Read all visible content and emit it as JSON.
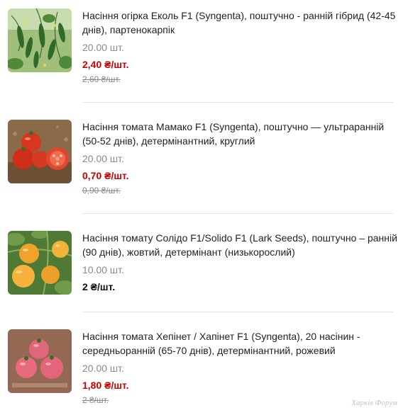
{
  "products": [
    {
      "image": "cucumber-photo",
      "title": "Насіння огірка Еколь F1 (Syngenta), поштучно - ранній гібрид (42-45 днів), партенокарпік",
      "quantity": "20.00 шт.",
      "price": "2,40 ₴/шт.",
      "old_price": "2,60 ₴/шт.",
      "price_color": "#cc0000"
    },
    {
      "image": "red-tomato-photo",
      "title": "Насіння томата Мамако F1 (Syngenta), поштучно — ультраранній (50-52 днів), детермінантний, круглий",
      "quantity": "20.00 шт.",
      "price": "0,70 ₴/шт.",
      "old_price": "0,90 ₴/шт.",
      "price_color": "#cc0000"
    },
    {
      "image": "yellow-tomato-photo",
      "title": "Насіння томату Солідо F1/Solido F1 (Lark Seeds), поштучно – ранній (90 днів), жовтий, детермінант (низькорослий)",
      "quantity": "10.00 шт.",
      "price": "2 ₴/шт.",
      "old_price": "",
      "price_color": "#111111"
    },
    {
      "image": "pink-tomato-photo",
      "title": "Насіння томата Хепінет / Хапінет F1 (Syngenta), 20 насінин - середньоранній (65-70 днів), детермінантний, рожевий",
      "quantity": "20.00 шт.",
      "price": "1,80 ₴/шт.",
      "old_price": "2 ₴/шт.",
      "price_color": "#cc0000"
    }
  ],
  "watermark": "Харків Форум"
}
